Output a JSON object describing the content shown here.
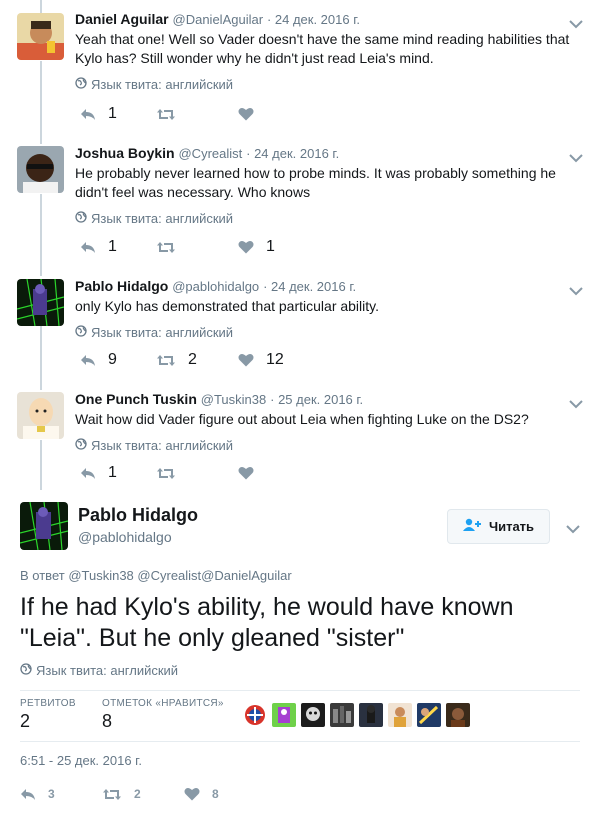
{
  "tweets": [
    {
      "name": "Daniel Aguilar",
      "handle": "@DanielAguilar",
      "date": "· 24 дек. 2016 г.",
      "text": "Yeah that one! Well so Vader doesn't have the same mind reading habilities that Kylo has? Still wonder why he didn't just read Leia's mind.",
      "lang": "Язык твита: английский",
      "replies": "1",
      "retweets": "",
      "likes": ""
    },
    {
      "name": "Joshua Boykin",
      "handle": "@Cyrealist",
      "date": "· 24 дек. 2016 г.",
      "text": "He probably never learned how to probe minds. It was probably something he didn't feel was necessary. Who knows",
      "lang": "Язык твита: английский",
      "replies": "1",
      "retweets": "",
      "likes": "1"
    },
    {
      "name": "Pablo Hidalgo",
      "handle": "@pablohidalgo",
      "date": "· 24 дек. 2016 г.",
      "text": "only Kylo has demonstrated that particular ability.",
      "lang": "Язык твита: английский",
      "replies": "9",
      "retweets": "2",
      "likes": "12"
    },
    {
      "name": "One Punch Tuskin",
      "handle": "@Tuskin38",
      "date": "· 25 дек. 2016 г.",
      "text": "Wait how did Vader figure out about Leia when fighting Luke on the DS2?",
      "lang": "Язык твита: английский",
      "replies": "1",
      "retweets": "",
      "likes": ""
    }
  ],
  "main": {
    "name": "Pablo Hidalgo",
    "handle": "@pablohidalgo",
    "follow_label": "Читать",
    "reply_prefix": "В ответ",
    "reply_to": "@Tuskin38 @Cyrealist@DanielAguilar",
    "text": "If he had Kylo's ability, he would have known \"Leia\". But he only gleaned \"sister\"",
    "lang": "Язык твита: английский",
    "retweets_label": "РЕТВИТОВ",
    "retweets_count": "2",
    "likes_label": "ОТМЕТОК «НРАВИТСЯ»",
    "likes_count": "8",
    "timestamp": "6:51 - 25 дек. 2016 г.",
    "replies": "3",
    "retweets": "2",
    "likes": "8"
  },
  "icons": [
    "globe-icon",
    "reply-icon",
    "retweet-icon",
    "heart-icon",
    "chevron-down-icon",
    "follow-person-icon"
  ],
  "colors": {
    "text": "#14171a",
    "meta": "#657786",
    "icon": "#8899a6",
    "border": "#e1e8ed"
  }
}
